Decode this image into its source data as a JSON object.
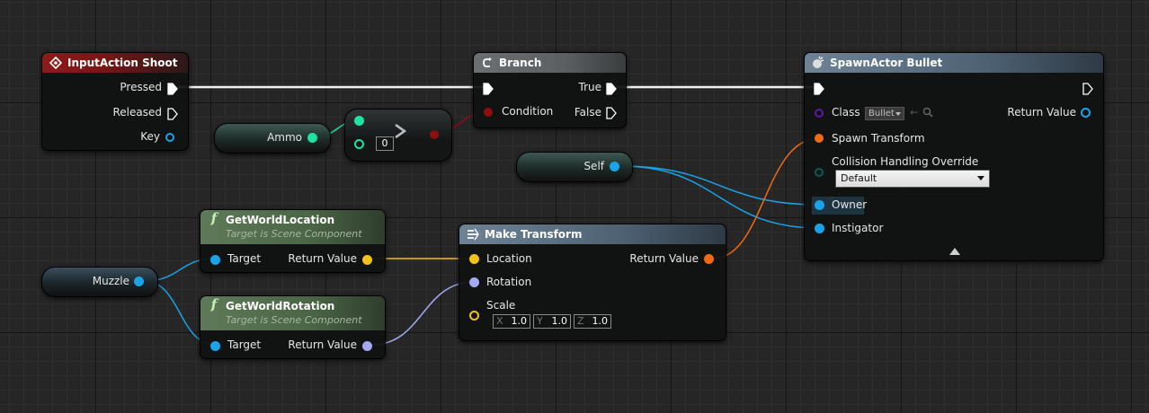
{
  "nodes": {
    "input_action": {
      "title": "InputAction Shoot",
      "pins": {
        "pressed": "Pressed",
        "released": "Released",
        "key": "Key"
      }
    },
    "branch": {
      "title": "Branch",
      "pins": {
        "condition": "Condition",
        "true": "True",
        "false": "False"
      }
    },
    "spawn_actor": {
      "title": "SpawnActor Bullet",
      "pins": {
        "class": "Class",
        "class_value": "Bullet",
        "return_value": "Return Value",
        "spawn_transform": "Spawn Transform",
        "collision": "Collision Handling Override",
        "collision_value": "Default",
        "owner": "Owner",
        "instigator": "Instigator"
      }
    },
    "ammo": {
      "label": "Ammo"
    },
    "compare": {
      "value": "0"
    },
    "self": {
      "label": "Self"
    },
    "muzzle": {
      "label": "Muzzle"
    },
    "get_world_location": {
      "title": "GetWorldLocation",
      "subtitle": "Target is Scene Component",
      "pins": {
        "target": "Target",
        "return_value": "Return Value"
      }
    },
    "get_world_rotation": {
      "title": "GetWorldRotation",
      "subtitle": "Target is Scene Component",
      "pins": {
        "target": "Target",
        "return_value": "Return Value"
      }
    },
    "make_transform": {
      "title": "Make Transform",
      "pins": {
        "location": "Location",
        "rotation": "Rotation",
        "scale": "Scale",
        "return_value": "Return Value",
        "scale_x_axis": "X",
        "scale_x": "1.0",
        "scale_y_axis": "Y",
        "scale_y": "1.0",
        "scale_z_axis": "Z",
        "scale_z": "1.0"
      }
    }
  },
  "colors": {
    "exec": "#ffffff",
    "object": "#1aa3e6",
    "int": "#1ee2a2",
    "bool": "#8c0f0f",
    "vector": "#f2c21a",
    "rotator": "#a3a8f0",
    "transform": "#f06a14",
    "class": "#5a1aa3"
  },
  "icons": {
    "input_action": "diamond-event-icon",
    "branch": "branch-icon",
    "spawn_actor": "spawn-actor-icon",
    "function": "function-f-icon",
    "make_transform": "make-struct-icon"
  }
}
